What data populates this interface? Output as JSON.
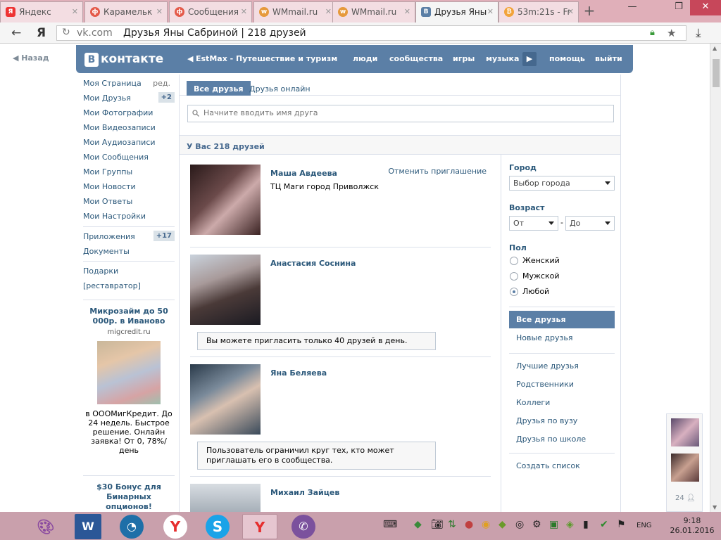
{
  "browser": {
    "tabs": [
      {
        "label": "Яндекс",
        "icon": "yandex-icon"
      },
      {
        "label": "Карамельк",
        "icon": "feed-icon"
      },
      {
        "label": "Сообщения",
        "icon": "feed-icon"
      },
      {
        "label": "WMmail.ru",
        "icon": "wmmail-icon"
      },
      {
        "label": "WMmail.ru",
        "icon": "wmmail-icon"
      },
      {
        "label": "Друзья Яны",
        "icon": "vk-icon"
      },
      {
        "label": "53m:21s - Fr",
        "icon": "bitcoin-icon"
      }
    ],
    "url": "vk.com",
    "page_title": "Друзья Яны Сабриной | 218 друзей"
  },
  "header": {
    "back_label": "Назад",
    "logo_letter": "В",
    "logo_text": "контакте",
    "player_text": "EstMax - Путешествие и туризм",
    "nav": [
      "люди",
      "сообщества",
      "игры",
      "музыка",
      "помощь",
      "выйти"
    ]
  },
  "left_menu": {
    "items": [
      {
        "label": "Моя Страница",
        "extra": "ред."
      },
      {
        "label": "Мои Друзья",
        "count": "+2"
      },
      {
        "label": "Мои Фотографии"
      },
      {
        "label": "Мои Видеозаписи"
      },
      {
        "label": "Мои Аудиозаписи"
      },
      {
        "label": "Мои Сообщения"
      },
      {
        "label": "Мои Группы"
      },
      {
        "label": "Мои Новости"
      },
      {
        "label": "Мои Ответы"
      },
      {
        "label": "Мои Настройки"
      }
    ],
    "apps": [
      {
        "label": "Приложения",
        "count": "+17"
      },
      {
        "label": "Документы"
      }
    ],
    "extras": [
      "Подарки",
      "[реставратор]"
    ],
    "ad1": {
      "title": "Микрозайм до 50 000р. в Иваново",
      "domain": "migcredit.ru",
      "text": "в ОООМигКредит. До 24 недель. Быстрое решение. Онлайн заявка! От 0, 78%/день"
    },
    "ad2": {
      "title": "$30 Бонус для Бинарных опционов!"
    }
  },
  "content": {
    "tabs": [
      "Все друзья",
      "Друзья онлайн"
    ],
    "search_placeholder": "Начните вводить имя друга",
    "count_label": "У Вас 218 друзей",
    "friends": [
      {
        "name": "Маша Авдеева",
        "sub": "ТЦ Маги город Приволжск",
        "action": "Отменить приглашение",
        "notice": ""
      },
      {
        "name": "Анастасия Соснина",
        "sub": "",
        "action": "",
        "notice": "Вы можете пригласить только 40 друзей в день."
      },
      {
        "name": "Яна Беляева",
        "sub": "",
        "action": "",
        "notice": "Пользователь ограничил круг тех, кто может приглашать его в сообщества."
      },
      {
        "name": "Михаил Зайцев",
        "sub": "",
        "action": "",
        "notice": ""
      }
    ]
  },
  "filters": {
    "city_label": "Город",
    "city_placeholder": "Выбор города",
    "age_label": "Возраст",
    "age_from": "От",
    "age_dash": "-",
    "age_to": "До",
    "gender_label": "Пол",
    "genders": [
      "Женский",
      "Мужской",
      "Любой"
    ],
    "gender_selected": "Любой",
    "menu1": [
      "Все друзья",
      "Новые друзья"
    ],
    "menu2": [
      "Лучшие друзья",
      "Родственники",
      "Коллеги",
      "Друзья по вузу",
      "Друзья по школе"
    ],
    "create_list": "Создать список"
  },
  "chat": {
    "online_count": "24"
  },
  "taskbar": {
    "lang": "ENG",
    "time": "9:18",
    "date": "26.01.2016"
  },
  "colors": {
    "vk_blue": "#5b7fa6",
    "link": "#2b587a",
    "taskbar": "#c9a0ac"
  }
}
